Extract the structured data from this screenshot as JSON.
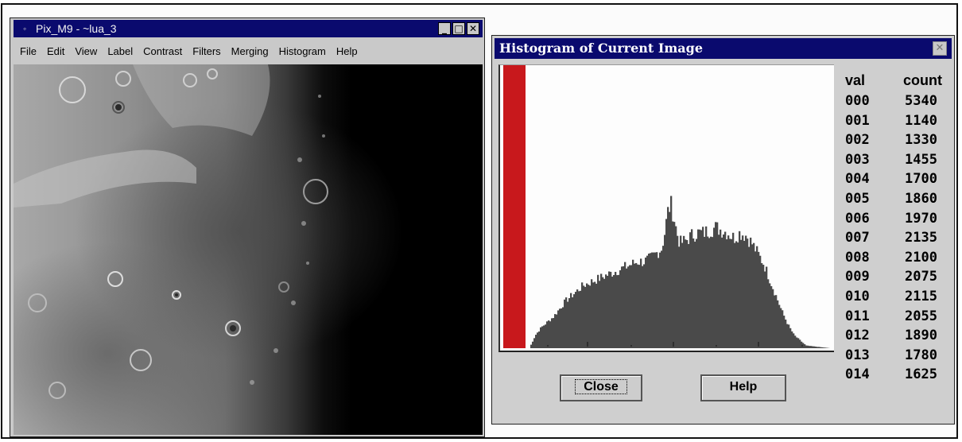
{
  "window_main": {
    "title_bullet": "◦",
    "title": "Pix_M9 - ~lua_3",
    "controls": [
      "_",
      "□",
      "✕"
    ],
    "menu": [
      "File",
      "Edit",
      "View",
      "Label",
      "Contrast",
      "Filters",
      "Merging",
      "Histogram",
      "Help"
    ]
  },
  "window_hist": {
    "title": "Histogram of Current Image",
    "close_glyph": "✕",
    "close_button": "Close",
    "help_button": "Help",
    "table_headers": {
      "val": "val",
      "count": "count"
    },
    "rows": [
      {
        "val": "000",
        "count": "5340"
      },
      {
        "val": "001",
        "count": "1140"
      },
      {
        "val": "002",
        "count": "1330"
      },
      {
        "val": "003",
        "count": "1455"
      },
      {
        "val": "004",
        "count": "1700"
      },
      {
        "val": "005",
        "count": "1860"
      },
      {
        "val": "006",
        "count": "1970"
      },
      {
        "val": "007",
        "count": "2135"
      },
      {
        "val": "008",
        "count": "2100"
      },
      {
        "val": "009",
        "count": "2075"
      },
      {
        "val": "010",
        "count": "2115"
      },
      {
        "val": "011",
        "count": "2055"
      },
      {
        "val": "012",
        "count": "1890"
      },
      {
        "val": "013",
        "count": "1780"
      },
      {
        "val": "014",
        "count": "1625"
      }
    ]
  },
  "colors": {
    "titlebar": "#0a0a6e",
    "histogram_bars": "#4a4a4a",
    "selected_bin": "#c8181c",
    "window_face": "#c9c9c9"
  },
  "chart_data": {
    "type": "bar",
    "highlighted_bin": "000",
    "shape": [
      [
        0,
        0.0
      ],
      [
        2,
        0.05
      ],
      [
        4,
        0.08
      ],
      [
        6,
        0.1
      ],
      [
        8,
        0.12
      ],
      [
        10,
        0.15
      ],
      [
        12,
        0.18
      ],
      [
        14,
        0.2
      ],
      [
        16,
        0.22
      ],
      [
        18,
        0.24
      ],
      [
        20,
        0.25
      ],
      [
        22,
        0.26
      ],
      [
        24,
        0.27
      ],
      [
        26,
        0.28
      ],
      [
        28,
        0.29
      ],
      [
        30,
        0.3
      ],
      [
        32,
        0.31
      ],
      [
        34,
        0.32
      ],
      [
        36,
        0.33
      ],
      [
        38,
        0.33
      ],
      [
        40,
        0.34
      ],
      [
        42,
        0.36
      ],
      [
        44,
        0.38
      ],
      [
        45,
        0.44
      ],
      [
        46,
        0.52
      ],
      [
        47,
        0.55
      ],
      [
        48,
        0.5
      ],
      [
        49,
        0.44
      ],
      [
        50,
        0.4
      ],
      [
        52,
        0.41
      ],
      [
        54,
        0.43
      ],
      [
        56,
        0.44
      ],
      [
        58,
        0.44
      ],
      [
        60,
        0.45
      ],
      [
        62,
        0.46
      ],
      [
        64,
        0.45
      ],
      [
        66,
        0.44
      ],
      [
        68,
        0.42
      ],
      [
        70,
        0.44
      ],
      [
        72,
        0.43
      ],
      [
        74,
        0.4
      ],
      [
        76,
        0.36
      ],
      [
        78,
        0.32
      ],
      [
        80,
        0.26
      ],
      [
        82,
        0.2
      ],
      [
        84,
        0.14
      ],
      [
        86,
        0.09
      ],
      [
        88,
        0.05
      ],
      [
        90,
        0.03
      ],
      [
        92,
        0.01
      ],
      [
        100,
        0.0
      ]
    ]
  }
}
